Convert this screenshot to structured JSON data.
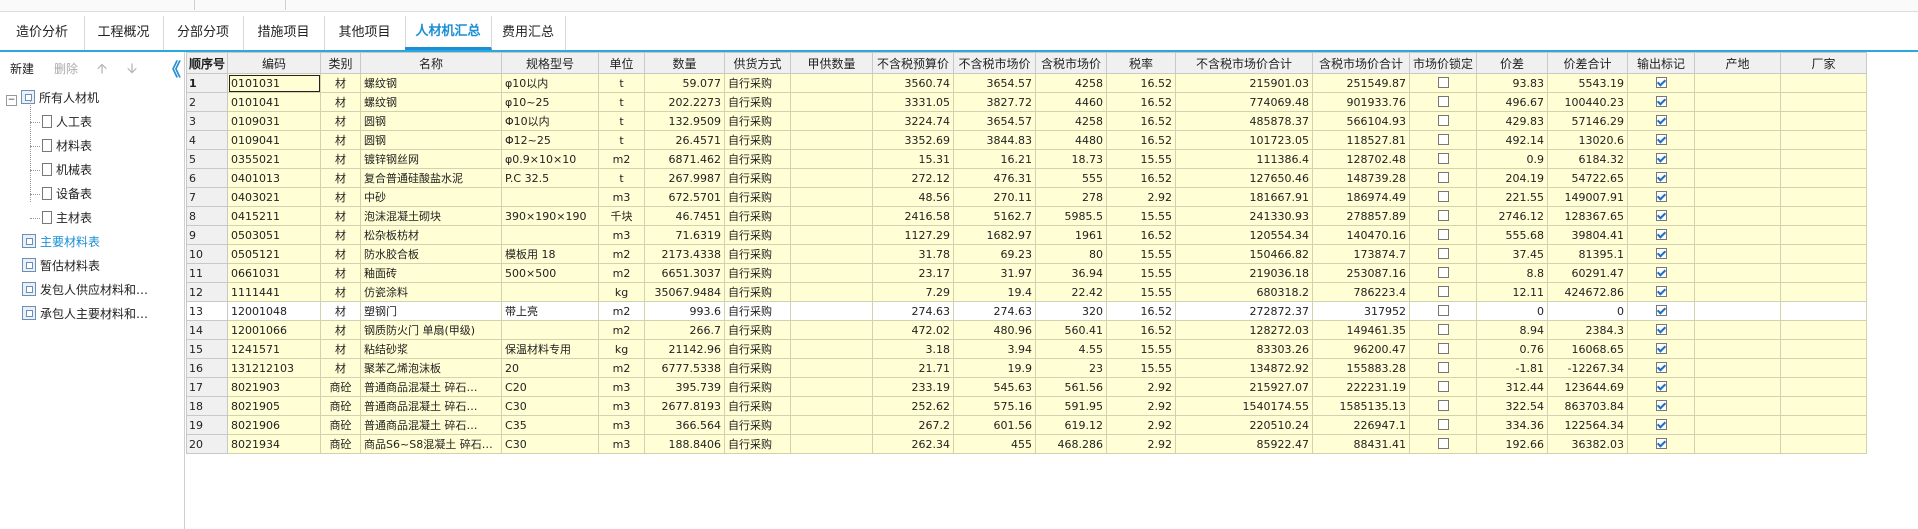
{
  "tabs": [
    "造价分析",
    "工程概况",
    "分部分项",
    "措施项目",
    "其他项目",
    "人材机汇总",
    "费用汇总"
  ],
  "active_tab": 5,
  "toolbar": {
    "new_label": "新建",
    "delete_label": "删除",
    "up_icon": "arrow-up-icon",
    "down_icon": "arrow-down-icon",
    "collapse_label": "《"
  },
  "tree": {
    "root": "所有人材机",
    "children": [
      "人工表",
      "材料表",
      "机械表",
      "设备表",
      "主材表"
    ],
    "groups": [
      "主要材料表",
      "暂估材料表",
      "发包人供应材料和…",
      "承包人主要材料和…"
    ]
  },
  "columns": [
    "顺序号",
    "编码",
    "类别",
    "名称",
    "规格型号",
    "单位",
    "数量",
    "供货方式",
    "甲供数量",
    "不含税预算价",
    "不含税市场价",
    "含税市场价",
    "税率",
    "不含税市场价合计",
    "含税市场价合计",
    "市场价锁定",
    "价差",
    "价差合计",
    "输出标记",
    "产地",
    "厂家"
  ],
  "rows": [
    [
      "1",
      "0101031",
      "材",
      "螺纹钢",
      "φ10以内",
      "t",
      "59.077",
      "自行采购",
      "",
      "3560.74",
      "3654.57",
      "4258",
      "16.52",
      "215901.03",
      "251549.87",
      false,
      "93.83",
      "5543.19",
      true,
      "",
      ""
    ],
    [
      "2",
      "0101041",
      "材",
      "螺纹钢",
      "φ10~25",
      "t",
      "202.2273",
      "自行采购",
      "",
      "3331.05",
      "3827.72",
      "4460",
      "16.52",
      "774069.48",
      "901933.76",
      false,
      "496.67",
      "100440.23",
      true,
      "",
      ""
    ],
    [
      "3",
      "0109031",
      "材",
      "圆钢",
      "Φ10以内",
      "t",
      "132.9509",
      "自行采购",
      "",
      "3224.74",
      "3654.57",
      "4258",
      "16.52",
      "485878.37",
      "566104.93",
      false,
      "429.83",
      "57146.29",
      true,
      "",
      ""
    ],
    [
      "4",
      "0109041",
      "材",
      "圆钢",
      "Φ12~25",
      "t",
      "26.4571",
      "自行采购",
      "",
      "3352.69",
      "3844.83",
      "4480",
      "16.52",
      "101723.05",
      "118527.81",
      false,
      "492.14",
      "13020.6",
      true,
      "",
      ""
    ],
    [
      "5",
      "0355021",
      "材",
      "镀锌钢丝网",
      "φ0.9×10×10",
      "m2",
      "6871.462",
      "自行采购",
      "",
      "15.31",
      "16.21",
      "18.73",
      "15.55",
      "111386.4",
      "128702.48",
      false,
      "0.9",
      "6184.32",
      true,
      "",
      ""
    ],
    [
      "6",
      "0401013",
      "材",
      "复合普通硅酸盐水泥",
      "P.C 32.5",
      "t",
      "267.9987",
      "自行采购",
      "",
      "272.12",
      "476.31",
      "555",
      "16.52",
      "127650.46",
      "148739.28",
      false,
      "204.19",
      "54722.65",
      true,
      "",
      ""
    ],
    [
      "7",
      "0403021",
      "材",
      "中砂",
      "",
      "m3",
      "672.5701",
      "自行采购",
      "",
      "48.56",
      "270.11",
      "278",
      "2.92",
      "181667.91",
      "186974.49",
      false,
      "221.55",
      "149007.91",
      true,
      "",
      ""
    ],
    [
      "8",
      "0415211",
      "材",
      "泡沫混凝土砌块",
      "390×190×190",
      "千块",
      "46.7451",
      "自行采购",
      "",
      "2416.58",
      "5162.7",
      "5985.5",
      "15.55",
      "241330.93",
      "278857.89",
      false,
      "2746.12",
      "128367.65",
      true,
      "",
      ""
    ],
    [
      "9",
      "0503051",
      "材",
      "松杂板枋材",
      "",
      "m3",
      "71.6319",
      "自行采购",
      "",
      "1127.29",
      "1682.97",
      "1961",
      "16.52",
      "120554.34",
      "140470.16",
      false,
      "555.68",
      "39804.41",
      true,
      "",
      ""
    ],
    [
      "10",
      "0505121",
      "材",
      "防水胶合板",
      "模板用 18",
      "m2",
      "2173.4338",
      "自行采购",
      "",
      "31.78",
      "69.23",
      "80",
      "15.55",
      "150466.82",
      "173874.7",
      false,
      "37.45",
      "81395.1",
      true,
      "",
      ""
    ],
    [
      "11",
      "0661031",
      "材",
      "釉面砖",
      "500×500",
      "m2",
      "6651.3037",
      "自行采购",
      "",
      "23.17",
      "31.97",
      "36.94",
      "15.55",
      "219036.18",
      "253087.16",
      false,
      "8.8",
      "60291.47",
      true,
      "",
      ""
    ],
    [
      "12",
      "1111441",
      "材",
      "仿瓷涂料",
      "",
      "kg",
      "35067.9484",
      "自行采购",
      "",
      "7.29",
      "19.4",
      "22.42",
      "15.55",
      "680318.2",
      "786223.4",
      false,
      "12.11",
      "424672.86",
      true,
      "",
      ""
    ],
    [
      "13",
      "12001048",
      "材",
      "塑钢门",
      "带上亮",
      "m2",
      "993.6",
      "自行采购",
      "",
      "274.63",
      "274.63",
      "320",
      "16.52",
      "272872.37",
      "317952",
      false,
      "0",
      "0",
      true,
      "",
      ""
    ],
    [
      "14",
      "12001066",
      "材",
      "钢质防火门 单扇(甲级)",
      "",
      "m2",
      "266.7",
      "自行采购",
      "",
      "472.02",
      "480.96",
      "560.41",
      "16.52",
      "128272.03",
      "149461.35",
      false,
      "8.94",
      "2384.3",
      true,
      "",
      ""
    ],
    [
      "15",
      "1241571",
      "材",
      "粘结砂浆",
      "保温材料专用",
      "kg",
      "21142.96",
      "自行采购",
      "",
      "3.18",
      "3.94",
      "4.55",
      "15.55",
      "83303.26",
      "96200.47",
      false,
      "0.76",
      "16068.65",
      true,
      "",
      ""
    ],
    [
      "16",
      "131212103",
      "材",
      "聚苯乙烯泡沫板",
      "20",
      "m2",
      "6777.5338",
      "自行采购",
      "",
      "21.71",
      "19.9",
      "23",
      "15.55",
      "134872.92",
      "155883.28",
      false,
      "-1.81",
      "-12267.34",
      true,
      "",
      ""
    ],
    [
      "17",
      "8021903",
      "商砼",
      "普通商品混凝土 碎石…",
      "C20",
      "m3",
      "395.739",
      "自行采购",
      "",
      "233.19",
      "545.63",
      "561.56",
      "2.92",
      "215927.07",
      "222231.19",
      false,
      "312.44",
      "123644.69",
      true,
      "",
      ""
    ],
    [
      "18",
      "8021905",
      "商砼",
      "普通商品混凝土 碎石…",
      "C30",
      "m3",
      "2677.8193",
      "自行采购",
      "",
      "252.62",
      "575.16",
      "591.95",
      "2.92",
      "1540174.55",
      "1585135.13",
      false,
      "322.54",
      "863703.84",
      true,
      "",
      ""
    ],
    [
      "19",
      "8021906",
      "商砼",
      "普通商品混凝土 碎石…",
      "C35",
      "m3",
      "366.564",
      "自行采购",
      "",
      "267.2",
      "601.56",
      "619.12",
      "2.92",
      "220510.24",
      "226947.1",
      false,
      "334.36",
      "122564.34",
      true,
      "",
      ""
    ],
    [
      "20",
      "8021934",
      "商砼",
      "商品S6~S8混凝土 碎石…",
      "C30",
      "m3",
      "188.8406",
      "自行采购",
      "",
      "262.34",
      "455",
      "468.286",
      "2.92",
      "85922.47",
      "88431.41",
      false,
      "192.66",
      "36382.03",
      true,
      "",
      ""
    ]
  ]
}
